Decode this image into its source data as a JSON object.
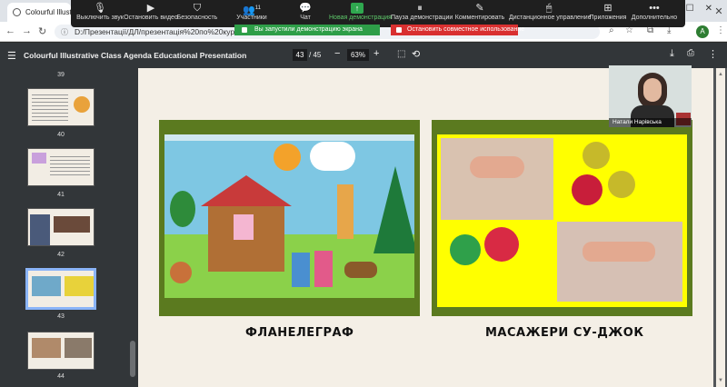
{
  "browser": {
    "tab_title": "Colourful Illustrati",
    "url": "D:/Презентації/ДЛ/презентація%20по%20курсо",
    "avatar_letter": "A"
  },
  "zoom": {
    "items": [
      {
        "icon": "microphone-icon",
        "label": "Выключить звук"
      },
      {
        "icon": "video-camera-icon",
        "label": "Остановить видео"
      },
      {
        "icon": "shield-icon",
        "label": "Безопасность"
      },
      {
        "icon": "participants-icon",
        "label": "Участники",
        "count": "11"
      },
      {
        "icon": "chat-icon",
        "label": "Чат"
      },
      {
        "icon": "share-screen-icon",
        "label": "Новая демонстрация"
      },
      {
        "icon": "pause-icon",
        "label": "Пауза демонстрации"
      },
      {
        "icon": "annotate-icon",
        "label": "Комментировать"
      },
      {
        "icon": "remote-control-icon",
        "label": "Дистанционное управление"
      },
      {
        "icon": "apps-icon",
        "label": "Приложения"
      },
      {
        "icon": "more-icon",
        "label": "Дополнительно"
      }
    ],
    "share_banner": "Вы запустили демонстрацию экрана",
    "stop_share": "Остановить совместное использование",
    "presenter_name": "Натали Нарівська"
  },
  "pdf": {
    "title": "Colourful Illustrative Class Agenda Educational Presentation",
    "page_current": "43",
    "page_total": "/ 45",
    "zoom": "63%"
  },
  "sidebar": {
    "thumbnails": [
      {
        "number": "39",
        "selected": false
      },
      {
        "number": "40",
        "selected": false
      },
      {
        "number": "41",
        "selected": false
      },
      {
        "number": "42",
        "selected": false
      },
      {
        "number": "43",
        "selected": true
      },
      {
        "number": "44",
        "selected": false
      }
    ]
  },
  "slide": {
    "left_caption": "ФЛАНЕЛЕГРАФ",
    "right_caption": "МАСАЖЕРИ СУ-ДЖОК",
    "frame_color": "#5b7a1f"
  }
}
